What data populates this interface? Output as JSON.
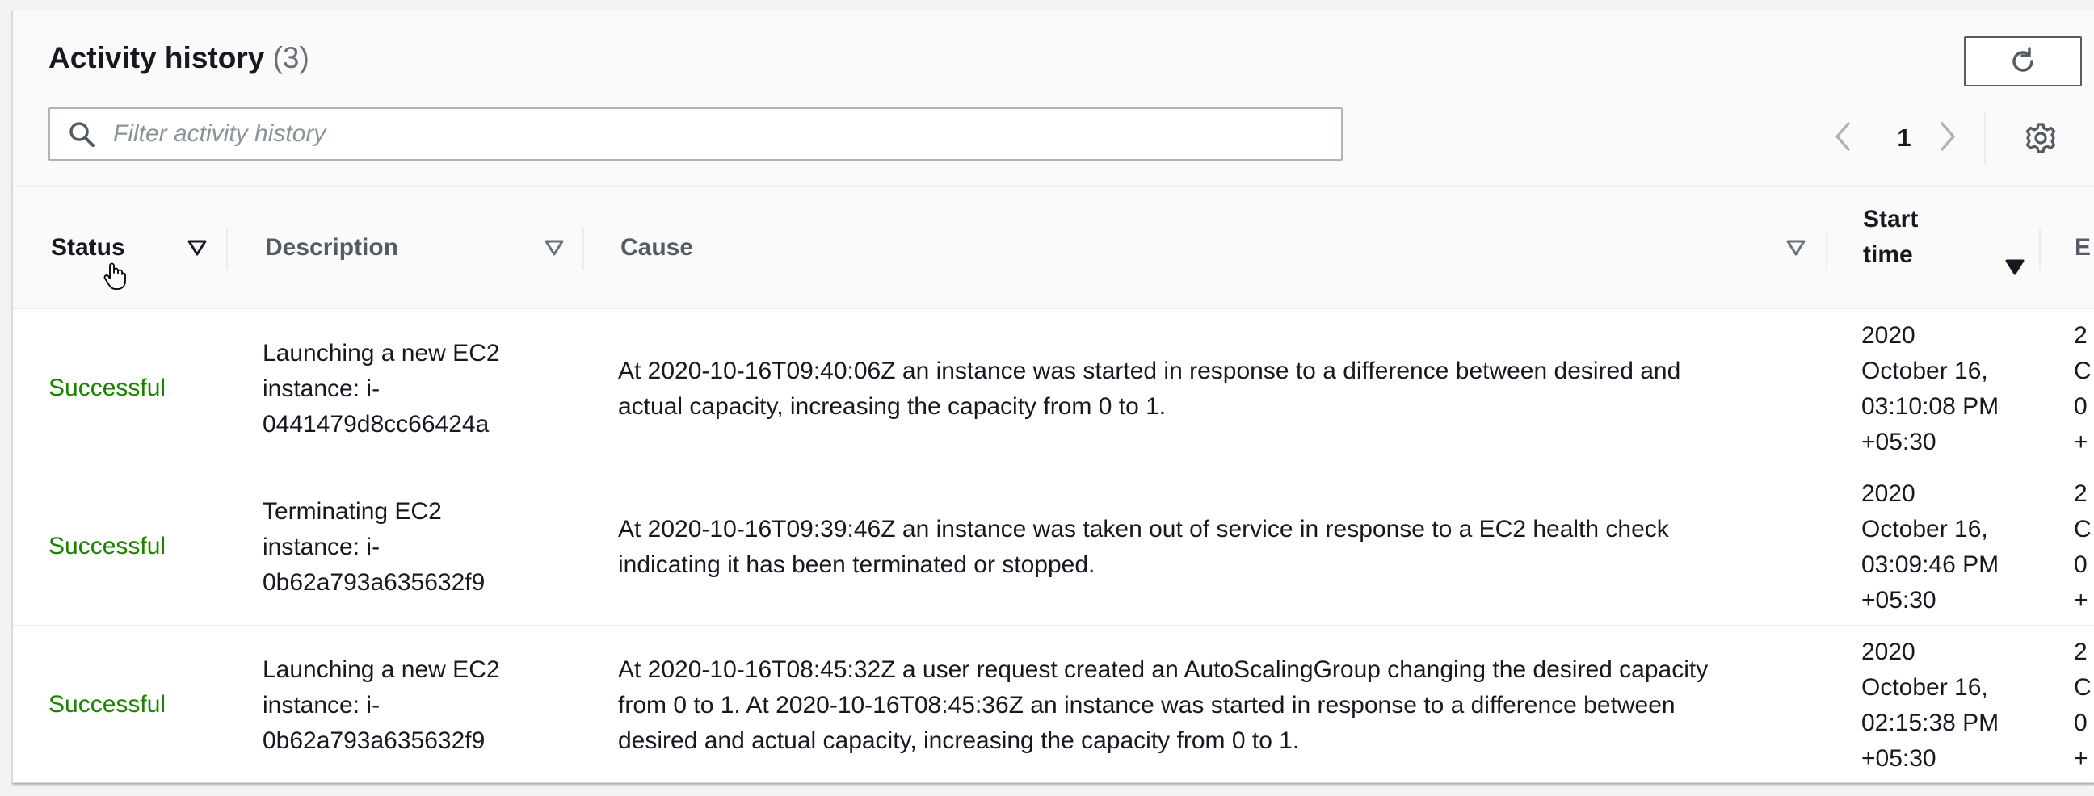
{
  "header": {
    "title": "Activity history",
    "count": "(3)"
  },
  "search": {
    "placeholder": "Filter activity history",
    "value": ""
  },
  "pagination": {
    "current_page": "1"
  },
  "table": {
    "columns": [
      {
        "key": "status",
        "label": "Status"
      },
      {
        "key": "description",
        "label": "Description"
      },
      {
        "key": "cause",
        "label": "Cause"
      },
      {
        "key": "start_time",
        "label_line1": "Start",
        "label_line2": "time"
      },
      {
        "key": "end_time",
        "label": "E"
      }
    ],
    "rows": [
      {
        "status": "Successful",
        "description_lines": [
          "Launching a new EC2",
          "instance: i-",
          "0441479d8cc66424a"
        ],
        "cause_lines": [
          "At 2020-10-16T09:40:06Z an instance was started in response to a difference between desired and",
          "actual capacity, increasing the capacity from 0 to 1."
        ],
        "start_lines": [
          "2020",
          "October 16,",
          "03:10:08 PM",
          "+05:30"
        ],
        "end_lines": [
          "2",
          "C",
          "0",
          "+"
        ]
      },
      {
        "status": "Successful",
        "description_lines": [
          "Terminating EC2",
          "instance: i-",
          "0b62a793a635632f9"
        ],
        "cause_lines": [
          "At 2020-10-16T09:39:46Z an instance was taken out of service in response to a EC2 health check",
          "indicating it has been terminated or stopped."
        ],
        "start_lines": [
          "2020",
          "October 16,",
          "03:09:46 PM",
          "+05:30"
        ],
        "end_lines": [
          "2",
          "C",
          "0",
          "+"
        ]
      },
      {
        "status": "Successful",
        "description_lines": [
          "Launching a new EC2",
          "instance: i-",
          "0b62a793a635632f9"
        ],
        "cause_lines": [
          "At 2020-10-16T08:45:32Z a user request created an AutoScalingGroup changing the desired capacity",
          "from 0 to 1. At 2020-10-16T08:45:36Z an instance was started in response to a difference between",
          "desired and actual capacity, increasing the capacity from 0 to 1."
        ],
        "start_lines": [
          "2020",
          "October 16,",
          "02:15:38 PM",
          "+05:30"
        ],
        "end_lines": [
          "2",
          "C",
          "0",
          "+"
        ]
      }
    ]
  },
  "colors": {
    "success": "#1d8102",
    "text": "#16191f",
    "muted": "#687078",
    "border": "#eaeded",
    "header_bg": "#fafafa"
  },
  "icons": [
    "refresh-icon",
    "search-icon",
    "chevron-left-icon",
    "chevron-right-icon",
    "settings-gear-icon",
    "sort-caret-icon",
    "sort-caret-filled-icon",
    "hand-cursor-icon"
  ]
}
